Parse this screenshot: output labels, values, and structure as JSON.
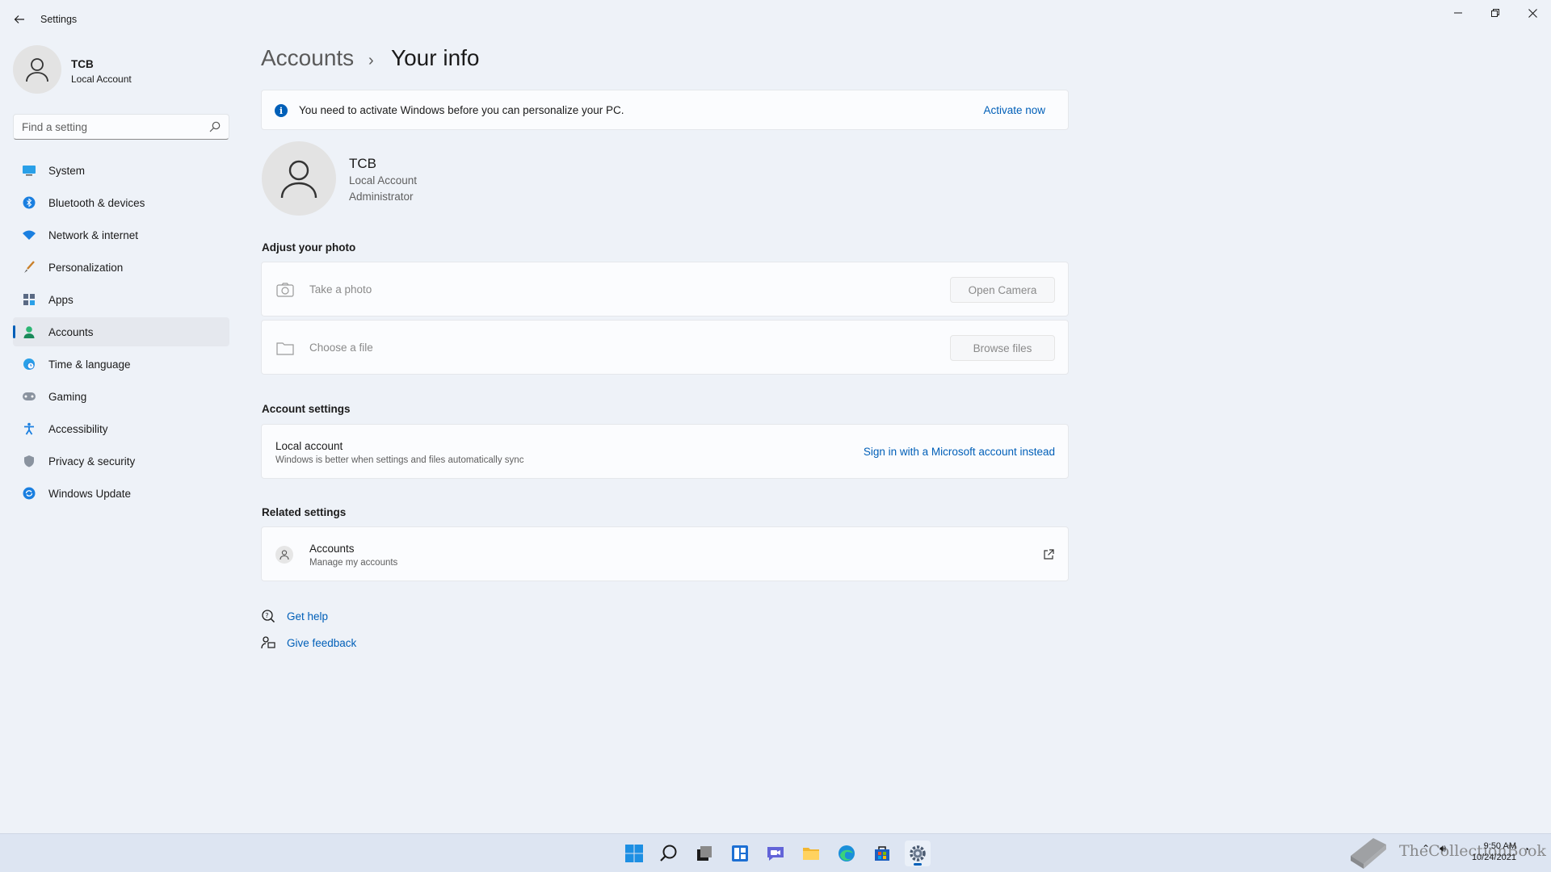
{
  "window": {
    "title": "Settings"
  },
  "profile": {
    "name": "TCB",
    "type": "Local Account"
  },
  "search": {
    "placeholder": "Find a setting"
  },
  "nav": [
    {
      "label": "System",
      "icon": "monitor-icon"
    },
    {
      "label": "Bluetooth & devices",
      "icon": "bluetooth-icon"
    },
    {
      "label": "Network & internet",
      "icon": "wifi-icon"
    },
    {
      "label": "Personalization",
      "icon": "brush-icon"
    },
    {
      "label": "Apps",
      "icon": "apps-icon"
    },
    {
      "label": "Accounts",
      "icon": "person-icon",
      "selected": true
    },
    {
      "label": "Time & language",
      "icon": "globe-clock-icon"
    },
    {
      "label": "Gaming",
      "icon": "gamepad-icon"
    },
    {
      "label": "Accessibility",
      "icon": "accessibility-icon"
    },
    {
      "label": "Privacy & security",
      "icon": "shield-icon"
    },
    {
      "label": "Windows Update",
      "icon": "update-icon"
    }
  ],
  "breadcrumb": {
    "parent": "Accounts",
    "separator": "›",
    "current": "Your info"
  },
  "banner": {
    "text": "You need to activate Windows before you can personalize your PC.",
    "link": "Activate now"
  },
  "user": {
    "name": "TCB",
    "type": "Local Account",
    "role": "Administrator"
  },
  "photo": {
    "heading": "Adjust your photo",
    "take": {
      "label": "Take a photo",
      "button": "Open Camera"
    },
    "file": {
      "label": "Choose a file",
      "button": "Browse files"
    }
  },
  "account_settings": {
    "heading": "Account settings",
    "title": "Local account",
    "subtitle": "Windows is better when settings and files automatically sync",
    "link": "Sign in with a Microsoft account instead"
  },
  "related": {
    "heading": "Related settings",
    "title": "Accounts",
    "subtitle": "Manage my accounts"
  },
  "help": {
    "get_help": "Get help",
    "give_feedback": "Give feedback"
  },
  "taskbar": {
    "time": "9:50 AM",
    "date": "10/24/2021",
    "apps": [
      "start-icon",
      "search-icon",
      "task-view-icon",
      "widgets-icon",
      "chat-icon",
      "file-explorer-icon",
      "edge-icon",
      "store-icon",
      "settings-icon"
    ]
  },
  "watermark": {
    "text": "TheCollectionBook"
  },
  "colors": {
    "accent": "#005fb8",
    "background": "#eef2f8",
    "card": "#fbfcfe"
  }
}
